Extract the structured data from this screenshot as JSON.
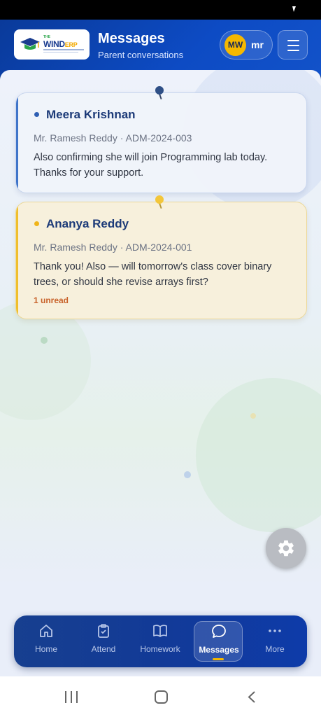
{
  "app": {
    "logo_text": "THE WIND ERP",
    "title": "Messages",
    "subtitle": "Parent conversations"
  },
  "user": {
    "initials": "MW",
    "name": "mr"
  },
  "conversations": [
    {
      "name": "Meera Krishnan",
      "meta": "Mr. Ramesh Reddy · ADM-2024-003",
      "message": "Also confirming she will join Programming lab today. Thanks for your support.",
      "unread": "",
      "accent": "#3f74c9"
    },
    {
      "name": "Ananya Reddy",
      "meta": "Mr. Ramesh Reddy · ADM-2024-001",
      "message": "Thank you! Also — will tomorrow's class cover binary trees, or should she revise arrays first?",
      "unread": "1 unread",
      "accent": "#f0bf2c"
    }
  ],
  "bottom_nav": [
    {
      "label": "Home",
      "icon": "home-icon"
    },
    {
      "label": "Attend",
      "icon": "clipboard-check-icon"
    },
    {
      "label": "Homework",
      "icon": "book-icon"
    },
    {
      "label": "Messages",
      "icon": "chat-bubble-icon",
      "active": true
    },
    {
      "label": "More",
      "icon": "more-dots-icon"
    }
  ],
  "colors": {
    "header_blue": "#0d4bc4",
    "accent_yellow": "#f5b800",
    "unread_orange": "#c8622a"
  }
}
